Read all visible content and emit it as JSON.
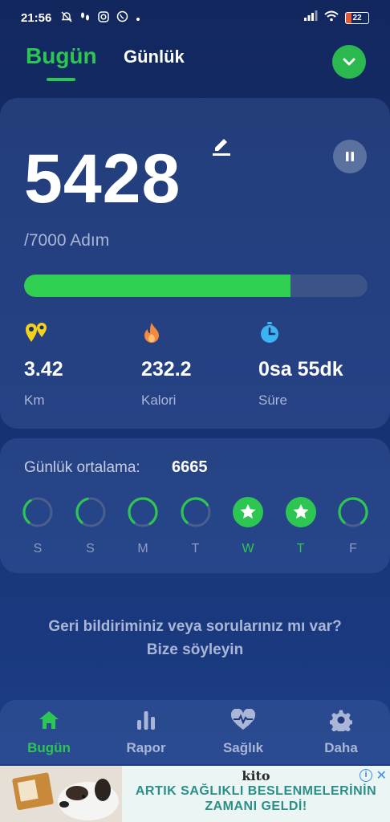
{
  "status_bar": {
    "time": "21:56",
    "battery": "22",
    "icons": [
      "mute-icon",
      "footsteps-icon",
      "instagram-icon",
      "whatsapp-icon",
      "signal-icon",
      "wifi-icon",
      "battery-icon"
    ]
  },
  "header": {
    "tab_today": "Bugün",
    "tab_daily": "Günlük"
  },
  "steps": {
    "value": "5428",
    "goal": "/7000 Adım",
    "progress": 0.7754
  },
  "stats": [
    {
      "icon": "location-icon",
      "value": "3.42",
      "label": "Km"
    },
    {
      "icon": "flame-icon",
      "value": "232.2",
      "label": "Kalori"
    },
    {
      "icon": "stopwatch-icon",
      "value": "0sa 55dk",
      "label": "Süre"
    }
  ],
  "week": {
    "avg_label": "Günlük ortalama:",
    "avg_value": "6665",
    "days": [
      {
        "label": "S",
        "fraction": 0.3,
        "goal_met": false
      },
      {
        "label": "S",
        "fraction": 0.35,
        "goal_met": false
      },
      {
        "label": "M",
        "fraction": 0.8,
        "goal_met": false
      },
      {
        "label": "T",
        "fraction": 0.55,
        "goal_met": false
      },
      {
        "label": "W",
        "fraction": 1.0,
        "goal_met": true
      },
      {
        "label": "T",
        "fraction": 1.0,
        "goal_met": true
      },
      {
        "label": "F",
        "fraction": 0.78,
        "goal_met": false
      }
    ]
  },
  "feedback": {
    "line1": "Geri bildiriminiz veya sorularınız mı var?",
    "line2": "Bize söyleyin"
  },
  "nav": [
    {
      "icon": "home-icon",
      "label": "Bugün",
      "active": true
    },
    {
      "icon": "bar-chart-icon",
      "label": "Rapor",
      "active": false
    },
    {
      "icon": "heart-pulse-icon",
      "label": "Sağlık",
      "active": false
    },
    {
      "icon": "gear-icon",
      "label": "Daha",
      "active": false
    }
  ],
  "ad": {
    "brand": "kito",
    "line1": "ARTIK SAĞLIKLI BESLENMELERİNİN",
    "line2": "ZAMANI GELDİ!"
  },
  "colors": {
    "accent": "#2dc653",
    "background": "#16306e",
    "muted_text": "#a9b6d6"
  }
}
